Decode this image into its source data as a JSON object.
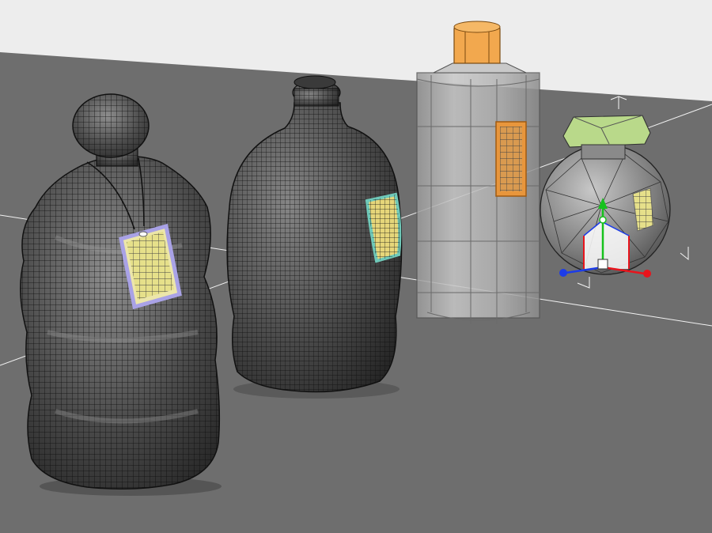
{
  "viewport": {
    "background_color": "#ededed",
    "ground_color": "#6e6e6e",
    "grid_line_color": "#f2f2f2",
    "mesh_line_color": "#0d0d0d"
  },
  "objects": [
    {
      "name": "lumpy-bottle",
      "body_color": "#4a4a4a",
      "display": "shaded-wireframe",
      "label_tag_color": "#e6e08a",
      "tag_border_color": "#a9a2e6"
    },
    {
      "name": "round-jug",
      "body_color": "#4a4a4a",
      "display": "shaded-wireframe",
      "label_color": "#e6d67a",
      "label_border_color": "#6fc9b9"
    },
    {
      "name": "glass-bottle",
      "body_color": "#bfbfbf",
      "display": "x-ray",
      "cap_color": "#f2a84e",
      "label_color": "#e8963c"
    },
    {
      "name": "sphere-bottle",
      "body_color": "#8a8a8a",
      "display": "low-poly-wireframe",
      "cap_color": "#b9d98a",
      "label_color": "#e6e08a",
      "selected": true
    }
  ],
  "gizmo": {
    "x_axis_color": "#e8141c",
    "y_axis_color": "#16c21c",
    "z_axis_color": "#1c3ce8",
    "icon": "transform-gizmo-icon"
  }
}
